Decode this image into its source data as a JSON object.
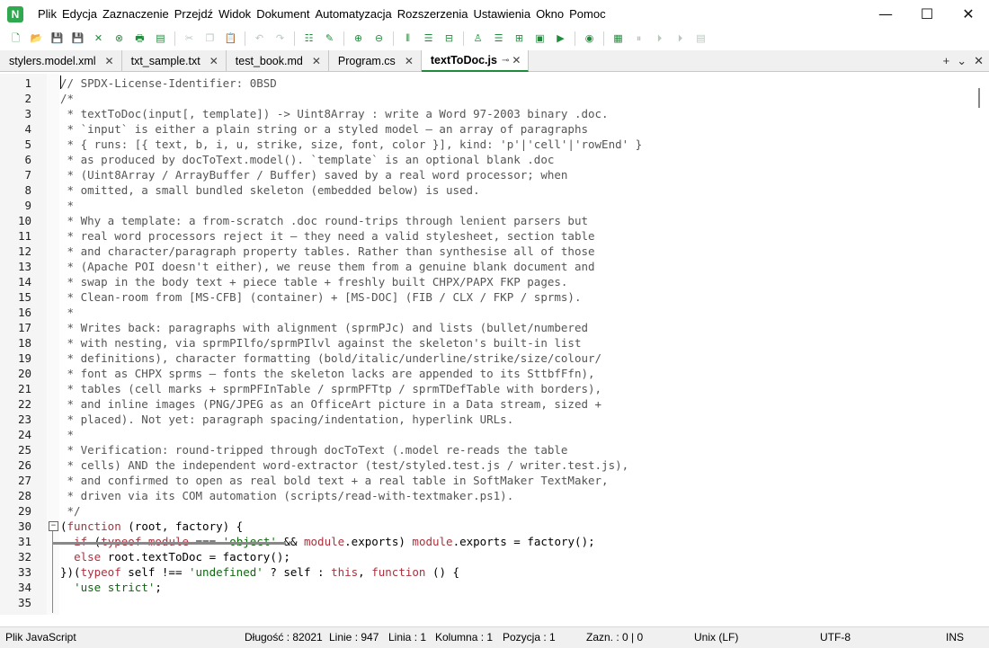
{
  "app": {
    "icon_letter": "N",
    "menu": [
      "Plik",
      "Edycja",
      "Zaznaczenie",
      "Przejdź",
      "Widok",
      "Dokument",
      "Automatyzacja",
      "Rozszerzenia",
      "Ustawienia",
      "Okno",
      "Pomoc"
    ]
  },
  "window_controls": {
    "minimize": "—",
    "maximize": "☐",
    "close": "✕"
  },
  "tabs": [
    {
      "label": "stylers.model.xml",
      "close": "✕"
    },
    {
      "label": "txt_sample.txt",
      "close": "✕"
    },
    {
      "label": "test_book.md",
      "close": "✕"
    },
    {
      "label": "Program.cs",
      "close": "✕"
    },
    {
      "label": "textToDoc.js",
      "pin": "⊸",
      "close": "✕"
    }
  ],
  "tab_controls": {
    "add": "+",
    "list": "⌄",
    "close": "✕"
  },
  "editor": {
    "lines": [
      {
        "n": "1",
        "html": "<span class='c'>// SPDX-License-Identifier: 0BSD</span>"
      },
      {
        "n": "2",
        "html": "<span class='c'>/*</span>"
      },
      {
        "n": "3",
        "html": "<span class='c'> * textToDoc(input[, template]) -> Uint8Array : write a Word 97-2003 binary .doc.</span>"
      },
      {
        "n": "4",
        "html": "<span class='c'> * `input` is either a plain string or a styled model — an array of paragraphs</span>"
      },
      {
        "n": "5",
        "html": "<span class='c'> * { runs: [{ text, b, i, u, strike, size, font, color }], kind: 'p'|'cell'|'rowEnd' }</span>"
      },
      {
        "n": "6",
        "html": "<span class='c'> * as produced by docToText.model(). `template` is an optional blank .doc</span>"
      },
      {
        "n": "7",
        "html": "<span class='c'> * (Uint8Array / ArrayBuffer / Buffer) saved by a real word processor; when</span>"
      },
      {
        "n": "8",
        "html": "<span class='c'> * omitted, a small bundled skeleton (embedded below) is used.</span>"
      },
      {
        "n": "9",
        "html": "<span class='c'> *</span>"
      },
      {
        "n": "10",
        "html": "<span class='c'> * Why a template: a from-scratch .doc round-trips through lenient parsers but</span>"
      },
      {
        "n": "11",
        "html": "<span class='c'> * real word processors reject it — they need a valid stylesheet, section table</span>"
      },
      {
        "n": "12",
        "html": "<span class='c'> * and character/paragraph property tables. Rather than synthesise all of those</span>"
      },
      {
        "n": "13",
        "html": "<span class='c'> * (Apache POI doesn't either), we reuse them from a genuine blank document and</span>"
      },
      {
        "n": "14",
        "html": "<span class='c'> * swap in the body text + piece table + freshly built CHPX/PAPX FKP pages.</span>"
      },
      {
        "n": "15",
        "html": "<span class='c'> * Clean-room from [MS-CFB] (container) + [MS-DOC] (FIB / CLX / FKP / sprms).</span>"
      },
      {
        "n": "16",
        "html": "<span class='c'> *</span>"
      },
      {
        "n": "17",
        "html": "<span class='c'> * Writes back: paragraphs with alignment (sprmPJc) and lists (bullet/numbered</span>"
      },
      {
        "n": "18",
        "html": "<span class='c'> * with nesting, via sprmPIlfo/sprmPIlvl against the skeleton's built-in list</span>"
      },
      {
        "n": "19",
        "html": "<span class='c'> * definitions), character formatting (bold/italic/underline/strike/size/colour/</span>"
      },
      {
        "n": "20",
        "html": "<span class='c'> * font as CHPX sprms — fonts the skeleton lacks are appended to its SttbfFfn),</span>"
      },
      {
        "n": "21",
        "html": "<span class='c'> * tables (cell marks + sprmPFInTable / sprmPFTtp / sprmTDefTable with borders),</span>"
      },
      {
        "n": "22",
        "html": "<span class='c'> * and inline images (PNG/JPEG as an OfficeArt picture in a Data stream, sized +</span>"
      },
      {
        "n": "23",
        "html": "<span class='c'> * placed). Not yet: paragraph spacing/indentation, hyperlink URLs.</span>"
      },
      {
        "n": "24",
        "html": "<span class='c'> *</span>"
      },
      {
        "n": "25",
        "html": "<span class='c'> * Verification: round-tripped through docToText (.model re-reads the table</span>"
      },
      {
        "n": "26",
        "html": "<span class='c'> * cells) AND the independent word-extractor (test/styled.test.js / writer.test.js),</span>"
      },
      {
        "n": "27",
        "html": "<span class='c'> * and confirmed to open as real bold text + a real table in SoftMaker TextMaker,</span>"
      },
      {
        "n": "28",
        "html": "<span class='c'> * driven via its COM automation (scripts/read-with-textmaker.ps1).</span>"
      },
      {
        "n": "29",
        "html": "<span class='c'> */</span>"
      },
      {
        "n": "30",
        "html": "(<span class='k'>function</span> (root, factory) {"
      },
      {
        "n": "31",
        "html": "  <span class='k'>if</span> (<span class='k'>typeof</span> <span class='k'>module</span> === <span class='s'>'object'</span> &amp;&amp; <span class='k'>module</span>.exports) <span class='k'>module</span>.exports = factory();"
      },
      {
        "n": "32",
        "html": "  <span class='k'>else</span> root.textToDoc = factory();"
      },
      {
        "n": "33",
        "html": "})(<span class='k'>typeof</span> self !== <span class='s'>'undefined'</span> ? self : <span class='k'>this</span>, <span class='k'>function</span> () {"
      },
      {
        "n": "34",
        "html": "  <span class='s'>'use strict'</span>;"
      },
      {
        "n": "35",
        "html": ""
      }
    ]
  },
  "status": {
    "file_type": "Plik JavaScript",
    "length": "Długość : 82021",
    "lines": "Linie : 947",
    "line": "Linia : 1",
    "column": "Kolumna : 1",
    "position": "Pozycja : 1",
    "selection": "Zazn. : 0 | 0",
    "eol": "Unix (LF)",
    "encoding": "UTF-8",
    "mode": "INS"
  }
}
